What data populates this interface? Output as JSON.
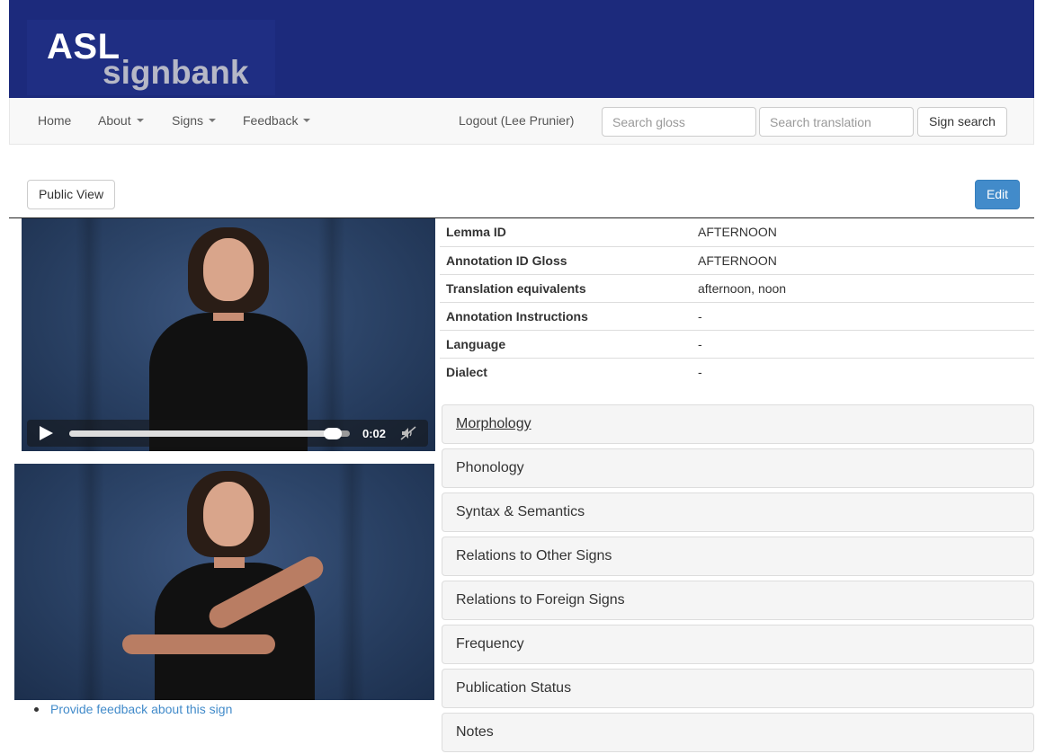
{
  "header": {
    "logo_line1": "ASL",
    "logo_line2": "signbank",
    "banner_color": "#1c2a7c"
  },
  "nav": {
    "home": "Home",
    "about": "About",
    "signs": "Signs",
    "feedback": "Feedback",
    "logout": "Logout (Lee Prunier)",
    "search_gloss_placeholder": "Search gloss",
    "search_translation_placeholder": "Search translation",
    "sign_search": "Sign search"
  },
  "toolbar": {
    "public_view": "Public View",
    "edit": "Edit",
    "edit_color": "#428bca"
  },
  "video": {
    "time": "0:02",
    "progress": 0.97,
    "icons": [
      "play-icon",
      "mute-icon"
    ]
  },
  "details": [
    {
      "label": "Lemma ID",
      "value": "AFTERNOON"
    },
    {
      "label": "Annotation ID Gloss",
      "value": "AFTERNOON"
    },
    {
      "label": "Translation equivalents",
      "value": "afternoon, noon"
    },
    {
      "label": "Annotation Instructions",
      "value": "-"
    },
    {
      "label": "Language",
      "value": "-"
    },
    {
      "label": "Dialect",
      "value": "-"
    }
  ],
  "panels": [
    "Morphology",
    "Phonology",
    "Syntax & Semantics",
    "Relations to Other Signs",
    "Relations to Foreign Signs",
    "Frequency",
    "Publication Status",
    "Notes"
  ],
  "feedback_link": "Provide feedback about this sign"
}
